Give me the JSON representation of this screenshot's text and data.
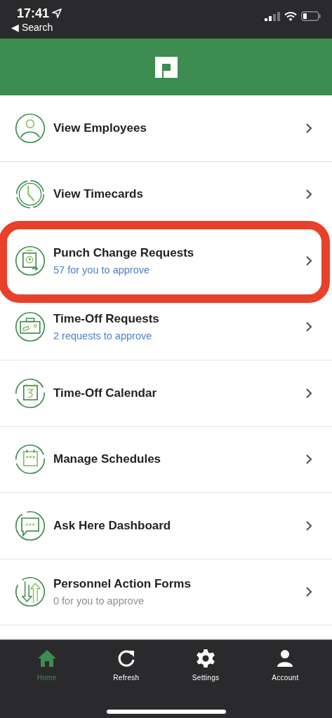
{
  "status_bar": {
    "time": "17:41",
    "back": "◀ Search"
  },
  "menu": [
    {
      "kind": "person",
      "title": "View Employees",
      "highlighted": false
    },
    {
      "kind": "clock",
      "title": "View Timecards",
      "highlighted": false
    },
    {
      "kind": "punch",
      "title": "Punch Change Requests",
      "subtitle": {
        "text": "57 for you to approve",
        "color": "#4a80c8"
      },
      "highlighted": true
    },
    {
      "kind": "briefcase",
      "title": "Time-Off Requests",
      "subtitle": {
        "text": "2 requests to approve",
        "color": "#4a80c8"
      },
      "highlighted": false
    },
    {
      "kind": "calendar",
      "title": "Time-Off Calendar",
      "highlighted": false
    },
    {
      "kind": "schedule",
      "title": "Manage Schedules",
      "highlighted": false
    },
    {
      "kind": "chat",
      "title": "Ask Here Dashboard",
      "highlighted": false
    },
    {
      "kind": "arrows",
      "title": "Personnel Action Forms",
      "subtitle": {
        "text": "0 for you to approve",
        "color": "#8e8e93"
      },
      "highlighted": false
    }
  ],
  "tab_bar": [
    {
      "kind": "home",
      "label": "Home",
      "selected": true
    },
    {
      "kind": "refresh",
      "label": "Refresh",
      "selected": false
    },
    {
      "kind": "settings",
      "label": "Settings",
      "selected": false
    },
    {
      "kind": "account",
      "label": "Account",
      "selected": false
    }
  ]
}
